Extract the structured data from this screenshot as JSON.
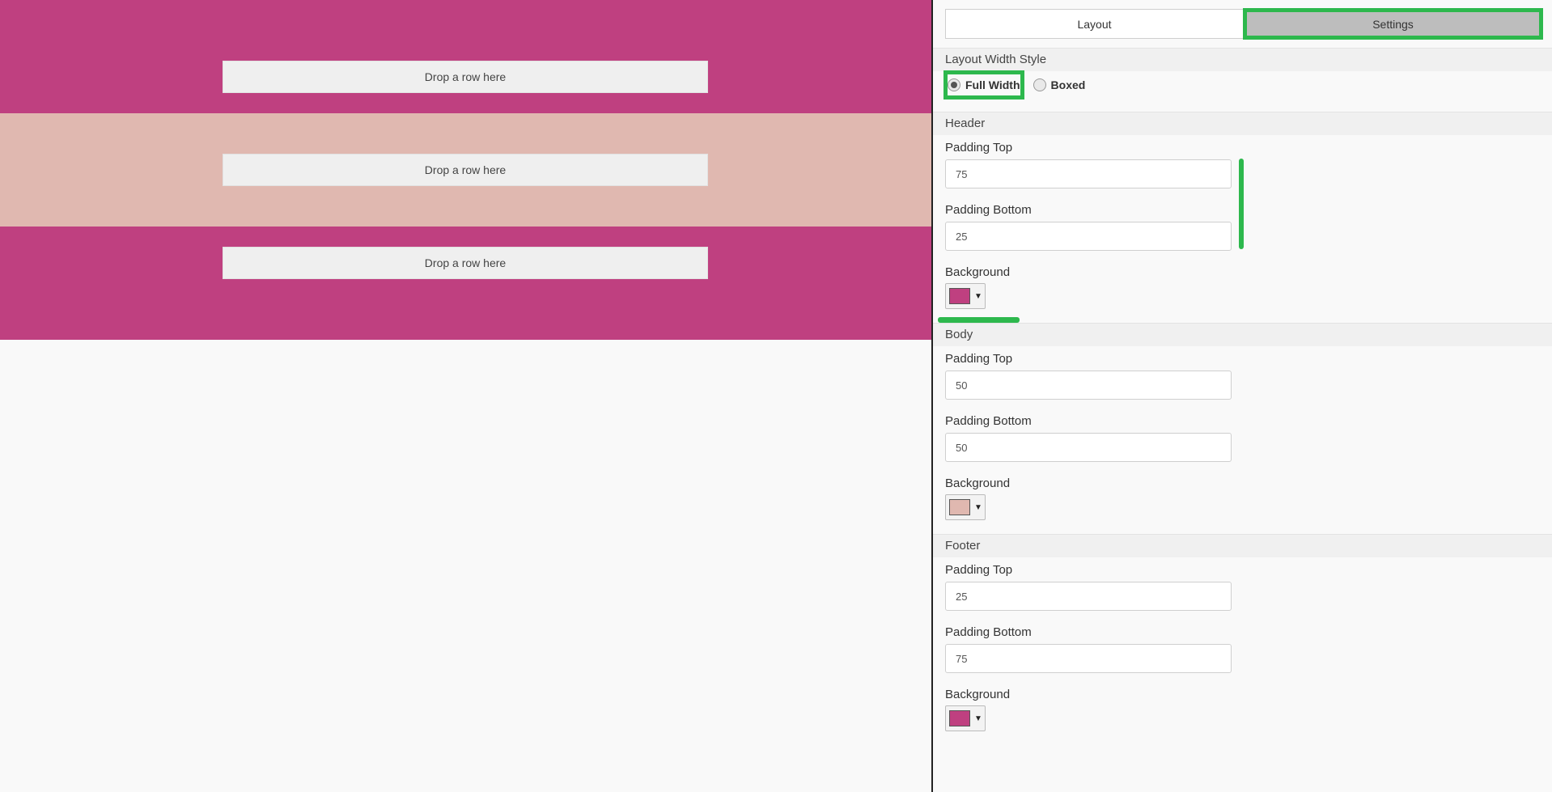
{
  "canvas": {
    "sections": [
      {
        "id": "header",
        "drop_label": "Drop a row here",
        "background": "#bf4080"
      },
      {
        "id": "body",
        "drop_label": "Drop a row here",
        "background": "#e0b8b0"
      },
      {
        "id": "footer",
        "drop_label": "Drop a row here",
        "background": "#bf4080"
      }
    ]
  },
  "panel": {
    "tabs": [
      {
        "label": "Layout",
        "active": false
      },
      {
        "label": "Settings",
        "active": true
      }
    ],
    "layout_width_style": {
      "title": "Layout Width Style",
      "options": [
        {
          "label": "Full Width",
          "checked": true
        },
        {
          "label": "Boxed",
          "checked": false
        }
      ]
    },
    "header": {
      "title": "Header",
      "padding_top_label": "Padding Top",
      "padding_top_value": "75",
      "padding_bottom_label": "Padding Bottom",
      "padding_bottom_value": "25",
      "background_label": "Background",
      "background_color": "#bf4080",
      "picker_icon": "chevron-down-icon"
    },
    "body": {
      "title": "Body",
      "padding_top_label": "Padding Top",
      "padding_top_value": "50",
      "padding_bottom_label": "Padding Bottom",
      "padding_bottom_value": "50",
      "background_label": "Background",
      "background_color": "#e0b8b0",
      "picker_icon": "chevron-down-icon"
    },
    "footer": {
      "title": "Footer",
      "padding_top_label": "Padding Top",
      "padding_top_value": "25",
      "padding_bottom_label": "Padding Bottom",
      "padding_bottom_value": "75",
      "background_label": "Background",
      "background_color": "#bf4080",
      "picker_icon": "chevron-down-icon"
    },
    "accent_highlight": "#2db84d"
  }
}
